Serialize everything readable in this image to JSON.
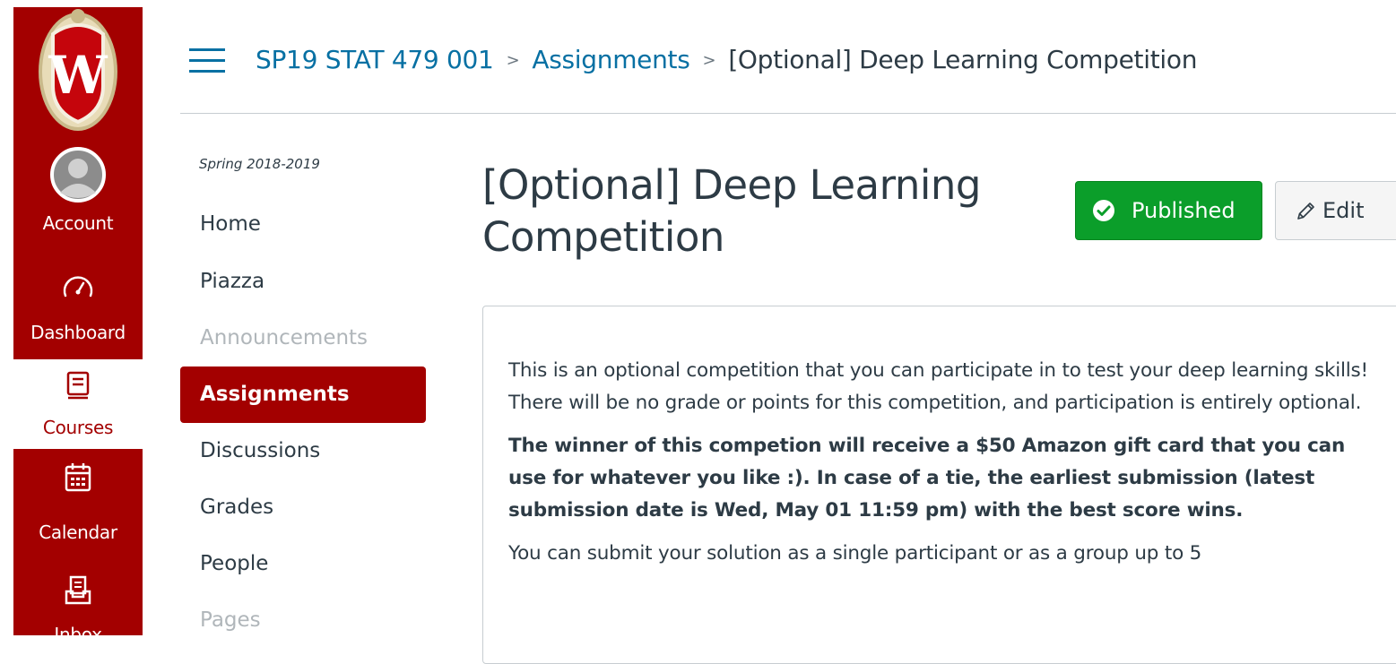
{
  "global_nav": {
    "bg_color": "#a30000",
    "items": [
      {
        "label": "Account",
        "icon": "user-avatar-icon"
      },
      {
        "label": "Dashboard",
        "icon": "speedometer-icon"
      },
      {
        "label": "Courses",
        "icon": "book-icon",
        "active": true
      },
      {
        "label": "Calendar",
        "icon": "calendar-icon"
      },
      {
        "label": "Inbox",
        "icon": "inbox-icon"
      }
    ]
  },
  "breadcrumb": {
    "course": "SP19 STAT 479 001",
    "section": "Assignments",
    "current": "[Optional] Deep Learning Competition",
    "separator": ">"
  },
  "course_nav": {
    "term": "Spring 2018-2019",
    "items": [
      {
        "label": "Home"
      },
      {
        "label": "Piazza"
      },
      {
        "label": "Announcements",
        "disabled": true
      },
      {
        "label": "Assignments",
        "active": true
      },
      {
        "label": "Discussions"
      },
      {
        "label": "Grades"
      },
      {
        "label": "People"
      },
      {
        "label": "Pages",
        "disabled": true
      }
    ]
  },
  "main": {
    "title": "[Optional] Deep Learning Competition",
    "published_label": "Published",
    "edit_label": "Edit",
    "paragraphs": [
      "This is an optional competition that you can participate in to test your deep learning skills! There will be no grade or points for this competition, and participation is entirely optional.",
      "The winner of this competion will receive a $50 Amazon gift card that you can use for whatever you like :). In case of a tie, the earliest submission (latest submission date is Wed, May 01 11:59 pm) with the best score wins.",
      "You can submit your solution as a single participant or as a group up to 5"
    ]
  },
  "colors": {
    "brand": "#a30000",
    "link": "#0770a3",
    "published": "#0b9e2a"
  }
}
